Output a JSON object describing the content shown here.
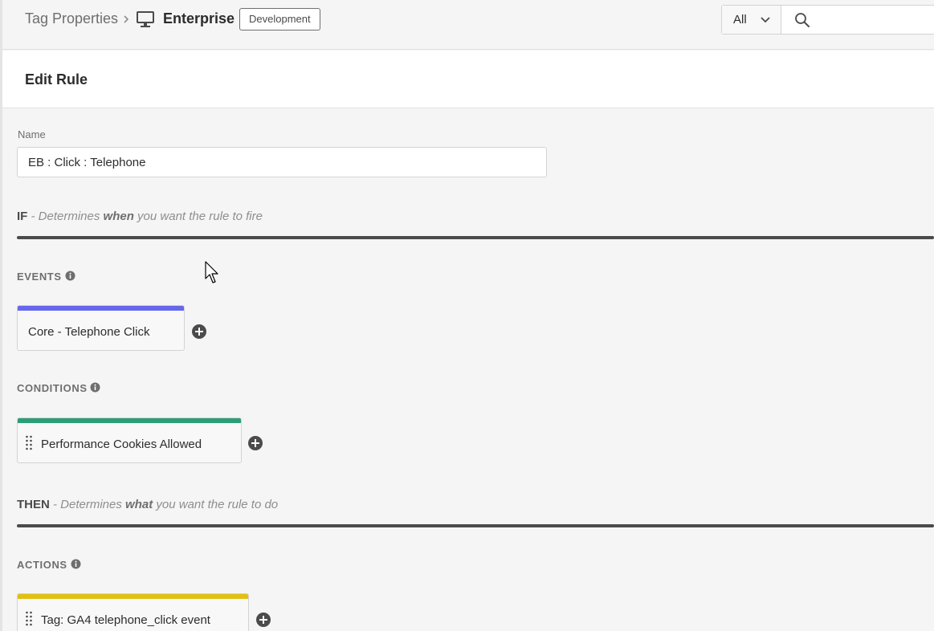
{
  "breadcrumb": {
    "root": "Tag Properties",
    "current": "Enterprise",
    "environment_badge": "Development"
  },
  "search": {
    "scope_value": "All",
    "placeholder": ""
  },
  "panel": {
    "title": "Edit Rule"
  },
  "form": {
    "name_label": "Name",
    "name_value": "EB : Click : Telephone"
  },
  "if_section": {
    "keyword": "IF",
    "desc_prefix": " - Determines ",
    "desc_emphasis": "when",
    "desc_suffix": " you want the rule to fire"
  },
  "events": {
    "label": "EVENTS",
    "items": [
      {
        "label": "Core - Telephone Click",
        "color": "#6767ec"
      }
    ]
  },
  "conditions": {
    "label": "CONDITIONS",
    "items": [
      {
        "label": "Performance Cookies Allowed",
        "color": "#2d9d78"
      }
    ]
  },
  "then_section": {
    "keyword": "THEN",
    "desc_prefix": " - Determines ",
    "desc_emphasis": "what",
    "desc_suffix": " you want the rule to do"
  },
  "actions": {
    "label": "ACTIONS",
    "items": [
      {
        "label": "Tag: GA4 telephone_click event",
        "color": "#e1c011"
      }
    ]
  },
  "icons": {
    "monitor": "monitor-icon",
    "breadcrumb_separator": "chevron-right-icon",
    "scope_dropdown": "chevron-down-icon",
    "search": "search-icon",
    "info": "info-icon",
    "add": "add-circle-icon",
    "drag": "drag-handle-icon",
    "cursor": "mouse-pointer-icon"
  }
}
